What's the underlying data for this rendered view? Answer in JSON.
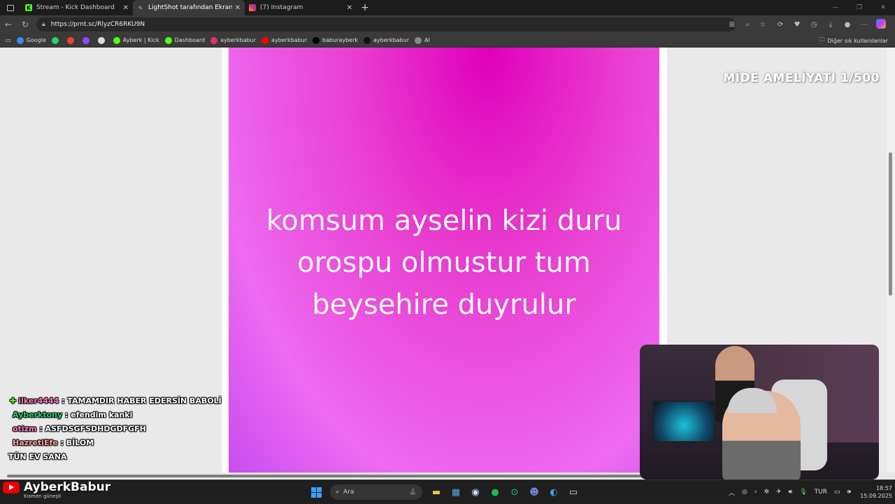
{
  "tabs": [
    {
      "title": "Stream - Kick Dashboard",
      "icon": "kick-icon",
      "active": false
    },
    {
      "title": "LightShot tarafından Ekran Görün",
      "icon": "lightshot-icon",
      "active": true
    },
    {
      "title": "(7) Instagram",
      "icon": "instagram-icon",
      "active": false
    }
  ],
  "address": {
    "url": "https://prnt.sc/RlyzCR6RKU9N"
  },
  "bookmarks": [
    {
      "label": "Google",
      "icon": "google-icon",
      "color": "#4285f4"
    },
    {
      "label": "",
      "icon": "whatsapp-icon",
      "color": "#25d366"
    },
    {
      "label": "",
      "icon": "gmail-icon",
      "color": "#ea4335"
    },
    {
      "label": "",
      "icon": "twitch-icon",
      "color": "#9146ff"
    },
    {
      "label": "",
      "icon": "diamond-icon",
      "color": "#dddddd"
    },
    {
      "label": "Ayberk | Kick",
      "icon": "kick-icon",
      "color": "#53fc18"
    },
    {
      "label": "Dashboard",
      "icon": "kick-icon",
      "color": "#53fc18"
    },
    {
      "label": "ayberkbabur",
      "icon": "instagram-icon",
      "color": "#e1306c"
    },
    {
      "label": "ayberkbabur",
      "icon": "youtube-icon",
      "color": "#ff0000"
    },
    {
      "label": "baburayberk",
      "icon": "x-icon",
      "color": "#000000"
    },
    {
      "label": "ayberkbabur",
      "icon": "tiktok-icon",
      "color": "#111111"
    },
    {
      "label": "AI",
      "icon": "ai-icon",
      "color": "#888888"
    }
  ],
  "bookmarks_other": "Diğer sık kullanılanlar",
  "screenshot": {
    "lines": [
      "komsum ayselin kizi duru",
      "orospu olmustur tum",
      "beysehire duyrulur"
    ]
  },
  "overlay_title": "MİDE AMELİYATI 1/500",
  "chat": [
    {
      "user": "ilker4444",
      "message": "TAMAMDIR HABER EDERSİN BABOLİ",
      "color": "#ff7bbf"
    },
    {
      "user": "Ayberktony",
      "message": "efendim kanki",
      "color": "#2ecc71"
    },
    {
      "user": "otizm",
      "message": "ASFDSGFSDHDGDFGFH",
      "color": "#ff7bbf"
    },
    {
      "user": "HazretiEfe",
      "message": "BİLOM",
      "color": "#ffa0a0"
    }
  ],
  "chat_last_line": "TÜN EV SANA",
  "brand": {
    "name": "AyberkBabur",
    "weather": "Kısmen güneşli"
  },
  "taskbar": {
    "search_placeholder": "Ara",
    "language": "TUR",
    "time": "18:57",
    "date": "15.09.2025"
  }
}
